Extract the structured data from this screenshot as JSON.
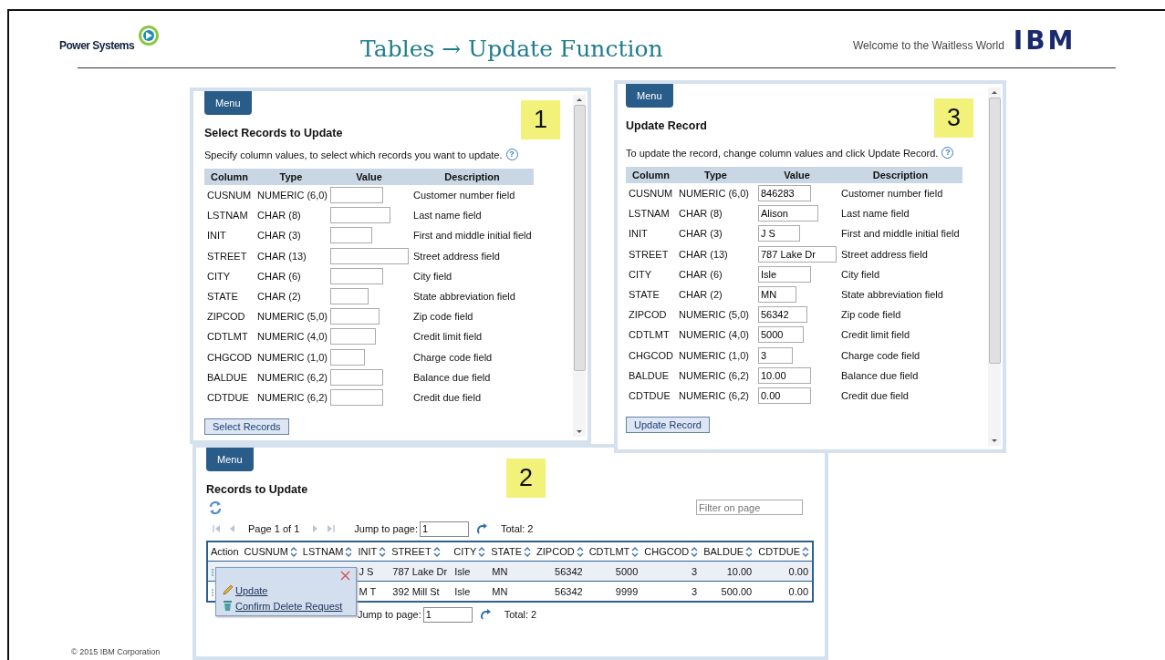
{
  "slide": {
    "logo_text": "Power Systems",
    "title": "Tables → Update Function",
    "tagline": "Welcome to the Waitless World",
    "brand": "IBM",
    "footer": "© 2015 IBM Corporation"
  },
  "panels": [
    {
      "kind": "select",
      "menu": "Menu",
      "heading": "Select Records to Update",
      "marker": "1",
      "instructions": "Specify column values, to select which records you want to update.",
      "help": "?",
      "columns": [
        "Column",
        "Type",
        "Value",
        "Description"
      ],
      "rows": [
        {
          "column": "CUSNUM",
          "type": "NUMERIC (6,0)",
          "description": "Customer number field"
        },
        {
          "column": "LSTNAM",
          "type": "CHAR (8)",
          "description": "Last name field"
        },
        {
          "column": "INIT",
          "type": "CHAR (3)",
          "description": "First and middle initial field"
        },
        {
          "column": "STREET",
          "type": "CHAR (13)",
          "description": "Street address field"
        },
        {
          "column": "CITY",
          "type": "CHAR (6)",
          "description": "City field"
        },
        {
          "column": "STATE",
          "type": "CHAR (2)",
          "description": "State abbreviation field"
        },
        {
          "column": "ZIPCOD",
          "type": "NUMERIC (5,0)",
          "description": "Zip code field"
        },
        {
          "column": "CDTLMT",
          "type": "NUMERIC (4,0)",
          "description": "Credit limit field"
        },
        {
          "column": "CHGCOD",
          "type": "NUMERIC (1,0)",
          "description": "Charge code field"
        },
        {
          "column": "BALDUE",
          "type": "NUMERIC (6,2)",
          "description": "Balance due field"
        },
        {
          "column": "CDTDUE",
          "type": "NUMERIC (6,2)",
          "description": "Credit due field"
        }
      ],
      "button": "Select Records"
    },
    {
      "kind": "update",
      "menu": "Menu",
      "heading": "Update Record",
      "marker": "3",
      "instructions": "To update the record, change column values and click Update Record.",
      "help": "?",
      "columns": [
        "Column",
        "Type",
        "Value",
        "Description"
      ],
      "rows": [
        {
          "column": "CUSNUM",
          "type": "NUMERIC (6,0)",
          "value": "846283",
          "description": "Customer number field"
        },
        {
          "column": "LSTNAM",
          "type": "CHAR (8)",
          "value": "Alison",
          "description": "Last name field"
        },
        {
          "column": "INIT",
          "type": "CHAR (3)",
          "value": "J S",
          "description": "First and middle initial field"
        },
        {
          "column": "STREET",
          "type": "CHAR (13)",
          "value": "787 Lake Dr",
          "description": "Street address field"
        },
        {
          "column": "CITY",
          "type": "CHAR (6)",
          "value": "Isle",
          "description": "City field"
        },
        {
          "column": "STATE",
          "type": "CHAR (2)",
          "value": "MN",
          "description": "State abbreviation field"
        },
        {
          "column": "ZIPCOD",
          "type": "NUMERIC (5,0)",
          "value": "56342",
          "description": "Zip code field"
        },
        {
          "column": "CDTLMT",
          "type": "NUMERIC (4,0)",
          "value": "5000",
          "description": "Credit limit field"
        },
        {
          "column": "CHGCOD",
          "type": "NUMERIC (1,0)",
          "value": "3",
          "description": "Charge code field"
        },
        {
          "column": "BALDUE",
          "type": "NUMERIC (6,2)",
          "value": "10.00",
          "description": "Balance due field"
        },
        {
          "column": "CDTDUE",
          "type": "NUMERIC (6,2)",
          "value": "0.00",
          "description": "Credit due field"
        }
      ],
      "button": "Update Record"
    },
    {
      "kind": "records",
      "menu": "Menu",
      "heading": "Records to Update",
      "marker": "2",
      "filter_placeholder": "Filter on page",
      "pager_top": {
        "page_label": "Page 1 of 1",
        "jump_label": "Jump to page:",
        "jump_value": "1",
        "total": "Total: 2"
      },
      "columns": [
        {
          "label": "Action",
          "sortable": false
        },
        {
          "label": "CUSNUM",
          "sortable": true,
          "numeric": true
        },
        {
          "label": "LSTNAM",
          "sortable": true,
          "numeric": false
        },
        {
          "label": "INIT",
          "sortable": true,
          "numeric": false
        },
        {
          "label": "STREET",
          "sortable": true,
          "numeric": false
        },
        {
          "label": "CITY",
          "sortable": true,
          "numeric": false
        },
        {
          "label": "STATE",
          "sortable": true,
          "numeric": false
        },
        {
          "label": "ZIPCOD",
          "sortable": true,
          "numeric": true
        },
        {
          "label": "CDTLMT",
          "sortable": true,
          "numeric": true
        },
        {
          "label": "CHGCOD",
          "sortable": true,
          "numeric": true
        },
        {
          "label": "BALDUE",
          "sortable": true,
          "numeric": true
        },
        {
          "label": "CDTDUE",
          "sortable": true,
          "numeric": true
        }
      ],
      "rows": [
        {
          "cells": [
            null,
            null,
            null,
            "J S",
            "787 Lake Dr",
            "Isle",
            "MN",
            "56342",
            "5000",
            "3",
            "10.00",
            "0.00"
          ]
        },
        {
          "cells": [
            null,
            null,
            null,
            "M T",
            "392 Mill St",
            "Isle",
            "MN",
            "56342",
            "9999",
            "3",
            "500.00",
            "0.00"
          ]
        }
      ],
      "pager_bottom": {
        "jump_label": "Jump to page:",
        "jump_value": "1",
        "total": "Total: 2"
      },
      "popup": {
        "items": [
          {
            "kind": "edit",
            "label": "Update"
          },
          {
            "kind": "delete",
            "label": "Confirm Delete Request"
          }
        ]
      }
    }
  ]
}
